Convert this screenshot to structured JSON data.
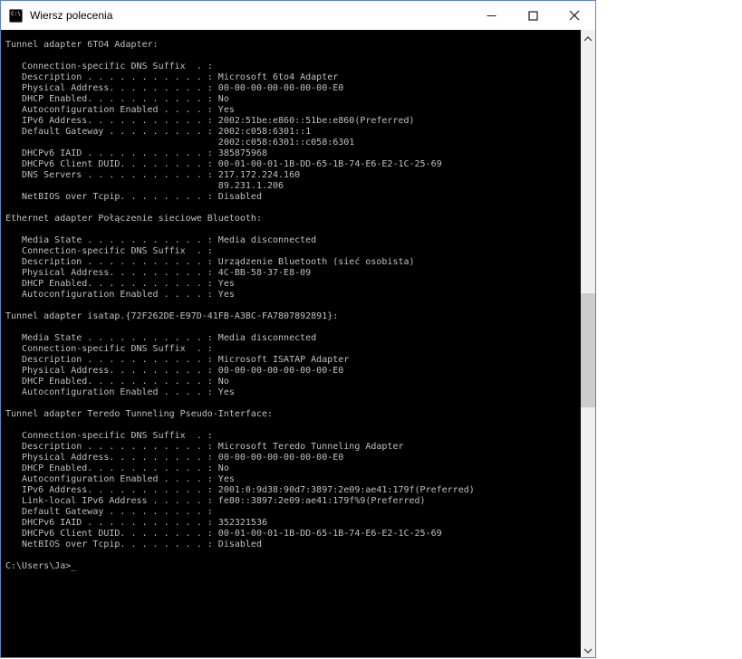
{
  "window": {
    "title": "Wiersz polecenia",
    "icon_text": "C:\\",
    "controls": {
      "minimize": "minimize",
      "maximize": "maximize",
      "close": "close"
    }
  },
  "terminal": {
    "lines": [
      "Tunnel adapter 6TO4 Adapter:",
      "",
      "   Connection-specific DNS Suffix  . :",
      "   Description . . . . . . . . . . . : Microsoft 6to4 Adapter",
      "   Physical Address. . . . . . . . . : 00-00-00-00-00-00-00-E0",
      "   DHCP Enabled. . . . . . . . . . . : No",
      "   Autoconfiguration Enabled . . . . : Yes",
      "   IPv6 Address. . . . . . . . . . . : 2002:51be:e860::51be:e860(Preferred)",
      "   Default Gateway . . . . . . . . . : 2002:c058:6301::1",
      "                                       2002:c058:6301::c058:6301",
      "   DHCPv6 IAID . . . . . . . . . . . : 385875968",
      "   DHCPv6 Client DUID. . . . . . . . : 00-01-00-01-1B-DD-65-1B-74-E6-E2-1C-25-69",
      "   DNS Servers . . . . . . . . . . . : 217.172.224.160",
      "                                       89.231.1.206",
      "   NetBIOS over Tcpip. . . . . . . . : Disabled",
      "",
      "Ethernet adapter Połączenie sieciowe Bluetooth:",
      "",
      "   Media State . . . . . . . . . . . : Media disconnected",
      "   Connection-specific DNS Suffix  . :",
      "   Description . . . . . . . . . . . : Urządzenie Bluetooth (sieć osobista)",
      "   Physical Address. . . . . . . . . : 4C-BB-58-37-E8-09",
      "   DHCP Enabled. . . . . . . . . . . : Yes",
      "   Autoconfiguration Enabled . . . . : Yes",
      "",
      "Tunnel adapter isatap.{72F262DE-E97D-41FB-A3BC-FA7807892891}:",
      "",
      "   Media State . . . . . . . . . . . : Media disconnected",
      "   Connection-specific DNS Suffix  . :",
      "   Description . . . . . . . . . . . : Microsoft ISATAP Adapter",
      "   Physical Address. . . . . . . . . : 00-00-00-00-00-00-00-E0",
      "   DHCP Enabled. . . . . . . . . . . : No",
      "   Autoconfiguration Enabled . . . . : Yes",
      "",
      "Tunnel adapter Teredo Tunneling Pseudo-Interface:",
      "",
      "   Connection-specific DNS Suffix  . :",
      "   Description . . . . . . . . . . . : Microsoft Teredo Tunneling Adapter",
      "   Physical Address. . . . . . . . . : 00-00-00-00-00-00-00-E0",
      "   DHCP Enabled. . . . . . . . . . . : No",
      "   Autoconfiguration Enabled . . . . : Yes",
      "   IPv6 Address. . . . . . . . . . . : 2001:0:9d38:90d7:3897:2e09:ae41:179f(Preferred)",
      "   Link-local IPv6 Address . . . . . : fe80::3897:2e09:ae41:179f%9(Preferred)",
      "   Default Gateway . . . . . . . . . :",
      "   DHCPv6 IAID . . . . . . . . . . . : 352321536",
      "   DHCPv6 Client DUID. . . . . . . . : 00-01-00-01-1B-DD-65-1B-74-E6-E2-1C-25-69",
      "   NetBIOS over Tcpip. . . . . . . . : Disabled",
      ""
    ],
    "prompt": "C:\\Users\\Ja>",
    "cursor": "_"
  },
  "colors": {
    "window_border": "#5c83c6",
    "titlebar_bg": "#ffffff",
    "terminal_bg": "#000000",
    "terminal_text": "#c0c0c0",
    "scrollbar_track": "#f0f0f0",
    "scrollbar_thumb": "#cdcdcd"
  }
}
